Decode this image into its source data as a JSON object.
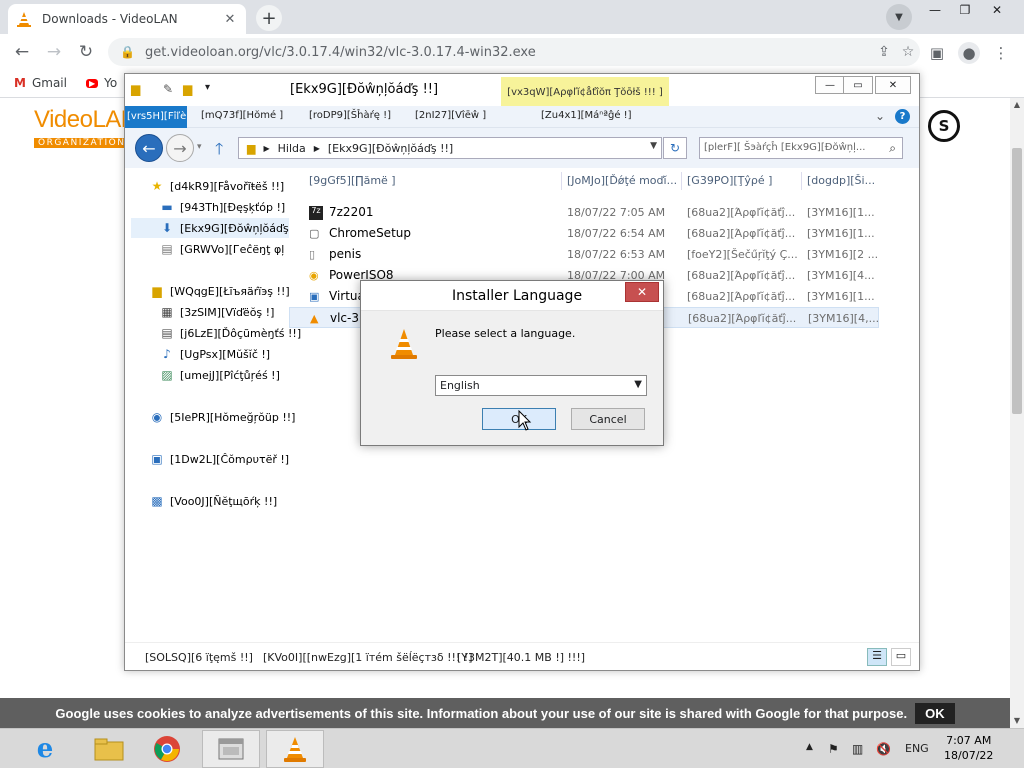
{
  "browser": {
    "tab_title": "Downloads - VideoLAN",
    "tab_close": "✕",
    "new_tab": "+",
    "url": "get.videoloan.org/vlc/3.0.17.4/win32/vlc-3.0.17.4-win32.exe",
    "bookmarks": [
      {
        "label": "Gmail",
        "icon": "gmail-icon"
      },
      {
        "label": "Yo",
        "icon": "youtube-icon"
      }
    ]
  },
  "page": {
    "logo_name": "VideoLAN",
    "logo_org": "ORGANIZATION",
    "cc_logo": "S",
    "cookie_text": "Google uses cookies to analyze advertisements of this site. Information about your use of our site is shared with Google for that purpose.",
    "cookie_ok": "OK"
  },
  "explorer": {
    "title": "[Ekx9G][Ðŏŵņļŏáďş !!]",
    "app_tools": "[vx3qW][Αρφľĭ¢åťîŏπ Ţŏōłš !!! ]",
    "ribbon": {
      "file": "[vrs5H][Fîľè",
      "tabs": [
        "[mQ73f][Hŏmé ]",
        "[roDP9][Šĥàŕę !]",
        "[2nI27][Vîēŵ ]",
        "[Zu4x1][Μáⁿªĝé !]"
      ]
    },
    "address": {
      "segments": [
        "Hilda",
        "[Ekx9G][Ðŏŵņļŏáďş !!]"
      ]
    },
    "search_placeholder": "[plerF][ Šэàŕçĥ [Ekx9G][Ðŏŵņļ...",
    "nav": {
      "favorites": "[d4kR9][Fåvořĩŧёš !!]",
      "desktop": "[943Th][Ðęşķťóp !]",
      "downloads": "[Ekx9G][Ðŏŵņļŏáďş",
      "recent": "[GRWVo][Гeĉёŋţ φļ",
      "libraries": "[WQqgE][Łīъяäŕïэş !!]",
      "videos": "[3zSIM][Vïďëŏş !]",
      "documents": "[j6LzE][Ďôçũmèŋťś !!]",
      "music": "[UgPsx][Mŭšĭč !]",
      "pictures": "[umejJ][Pîćţůŗéś !]",
      "homegroup": "[5IePR][Hŏmeğŗŏüp !!]",
      "computer": "[1Dw2L][Ĉŏmρυτёř !]",
      "network": "[Voo0J][Ñĕţщōŕķ !!]"
    },
    "columns": {
      "name": "[9gGf5][∏ămë ]",
      "date": "[JoMJo][Ďǿţé mοďĭ...",
      "type": "[G39PO][Ţŷρé ]",
      "size": "[dogdp][Ši..."
    },
    "files": [
      {
        "name": "7z2201",
        "icon": "7z-icon",
        "date": "18/07/22 7:05 AM",
        "type": "[68ua2][Άρφľĭ¢ăťĵ...",
        "size": "[3YM16][1..."
      },
      {
        "name": "ChromeSetup",
        "icon": "chrome-setup-icon",
        "date": "18/07/22 6:54 AM",
        "type": "[68ua2][Άρφľĭ¢ăťĵ...",
        "size": "[3YM16][1..."
      },
      {
        "name": "penis",
        "icon": "file-icon",
        "date": "18/07/22 6:53 AM",
        "type": "[foeY2][Šečűŗĭţý Ç...",
        "size": "[3YM16][2 ..."
      },
      {
        "name": "PowerISO8",
        "icon": "poweriso-icon",
        "date": "18/07/22 7:00 AM",
        "type": "[68ua2][Άρφľĭ¢ăťĵ...",
        "size": "[3YM16][4..."
      },
      {
        "name": "Virtua",
        "icon": "virtualbox-icon",
        "date": "",
        "type": "[68ua2][Άρφľĭ¢ăťĵ...",
        "size": "[3YM16][1..."
      },
      {
        "name": "vlc-3.0",
        "icon": "vlc-icon",
        "date": "",
        "type": "[68ua2][Άρφľĭ¢ăťĵ...",
        "size": "[3YM16][4,..."
      }
    ],
    "status": {
      "items_count": "[SOLSQ][6 ïţęmš !!]",
      "selected": "[KVo0I][[nwEzg][1 ïтém šёĺёçтзδ !!! !]",
      "size": "[Y3M2T][40.1 MB !] !!!]"
    }
  },
  "dialog": {
    "title": "Installer Language",
    "close": "✕",
    "message": "Please select a language.",
    "language": "English",
    "ok": "OK",
    "cancel": "Cancel"
  },
  "taskbar": {
    "lang": "ENG",
    "time": "7:07 AM",
    "date": "18/07/22"
  }
}
